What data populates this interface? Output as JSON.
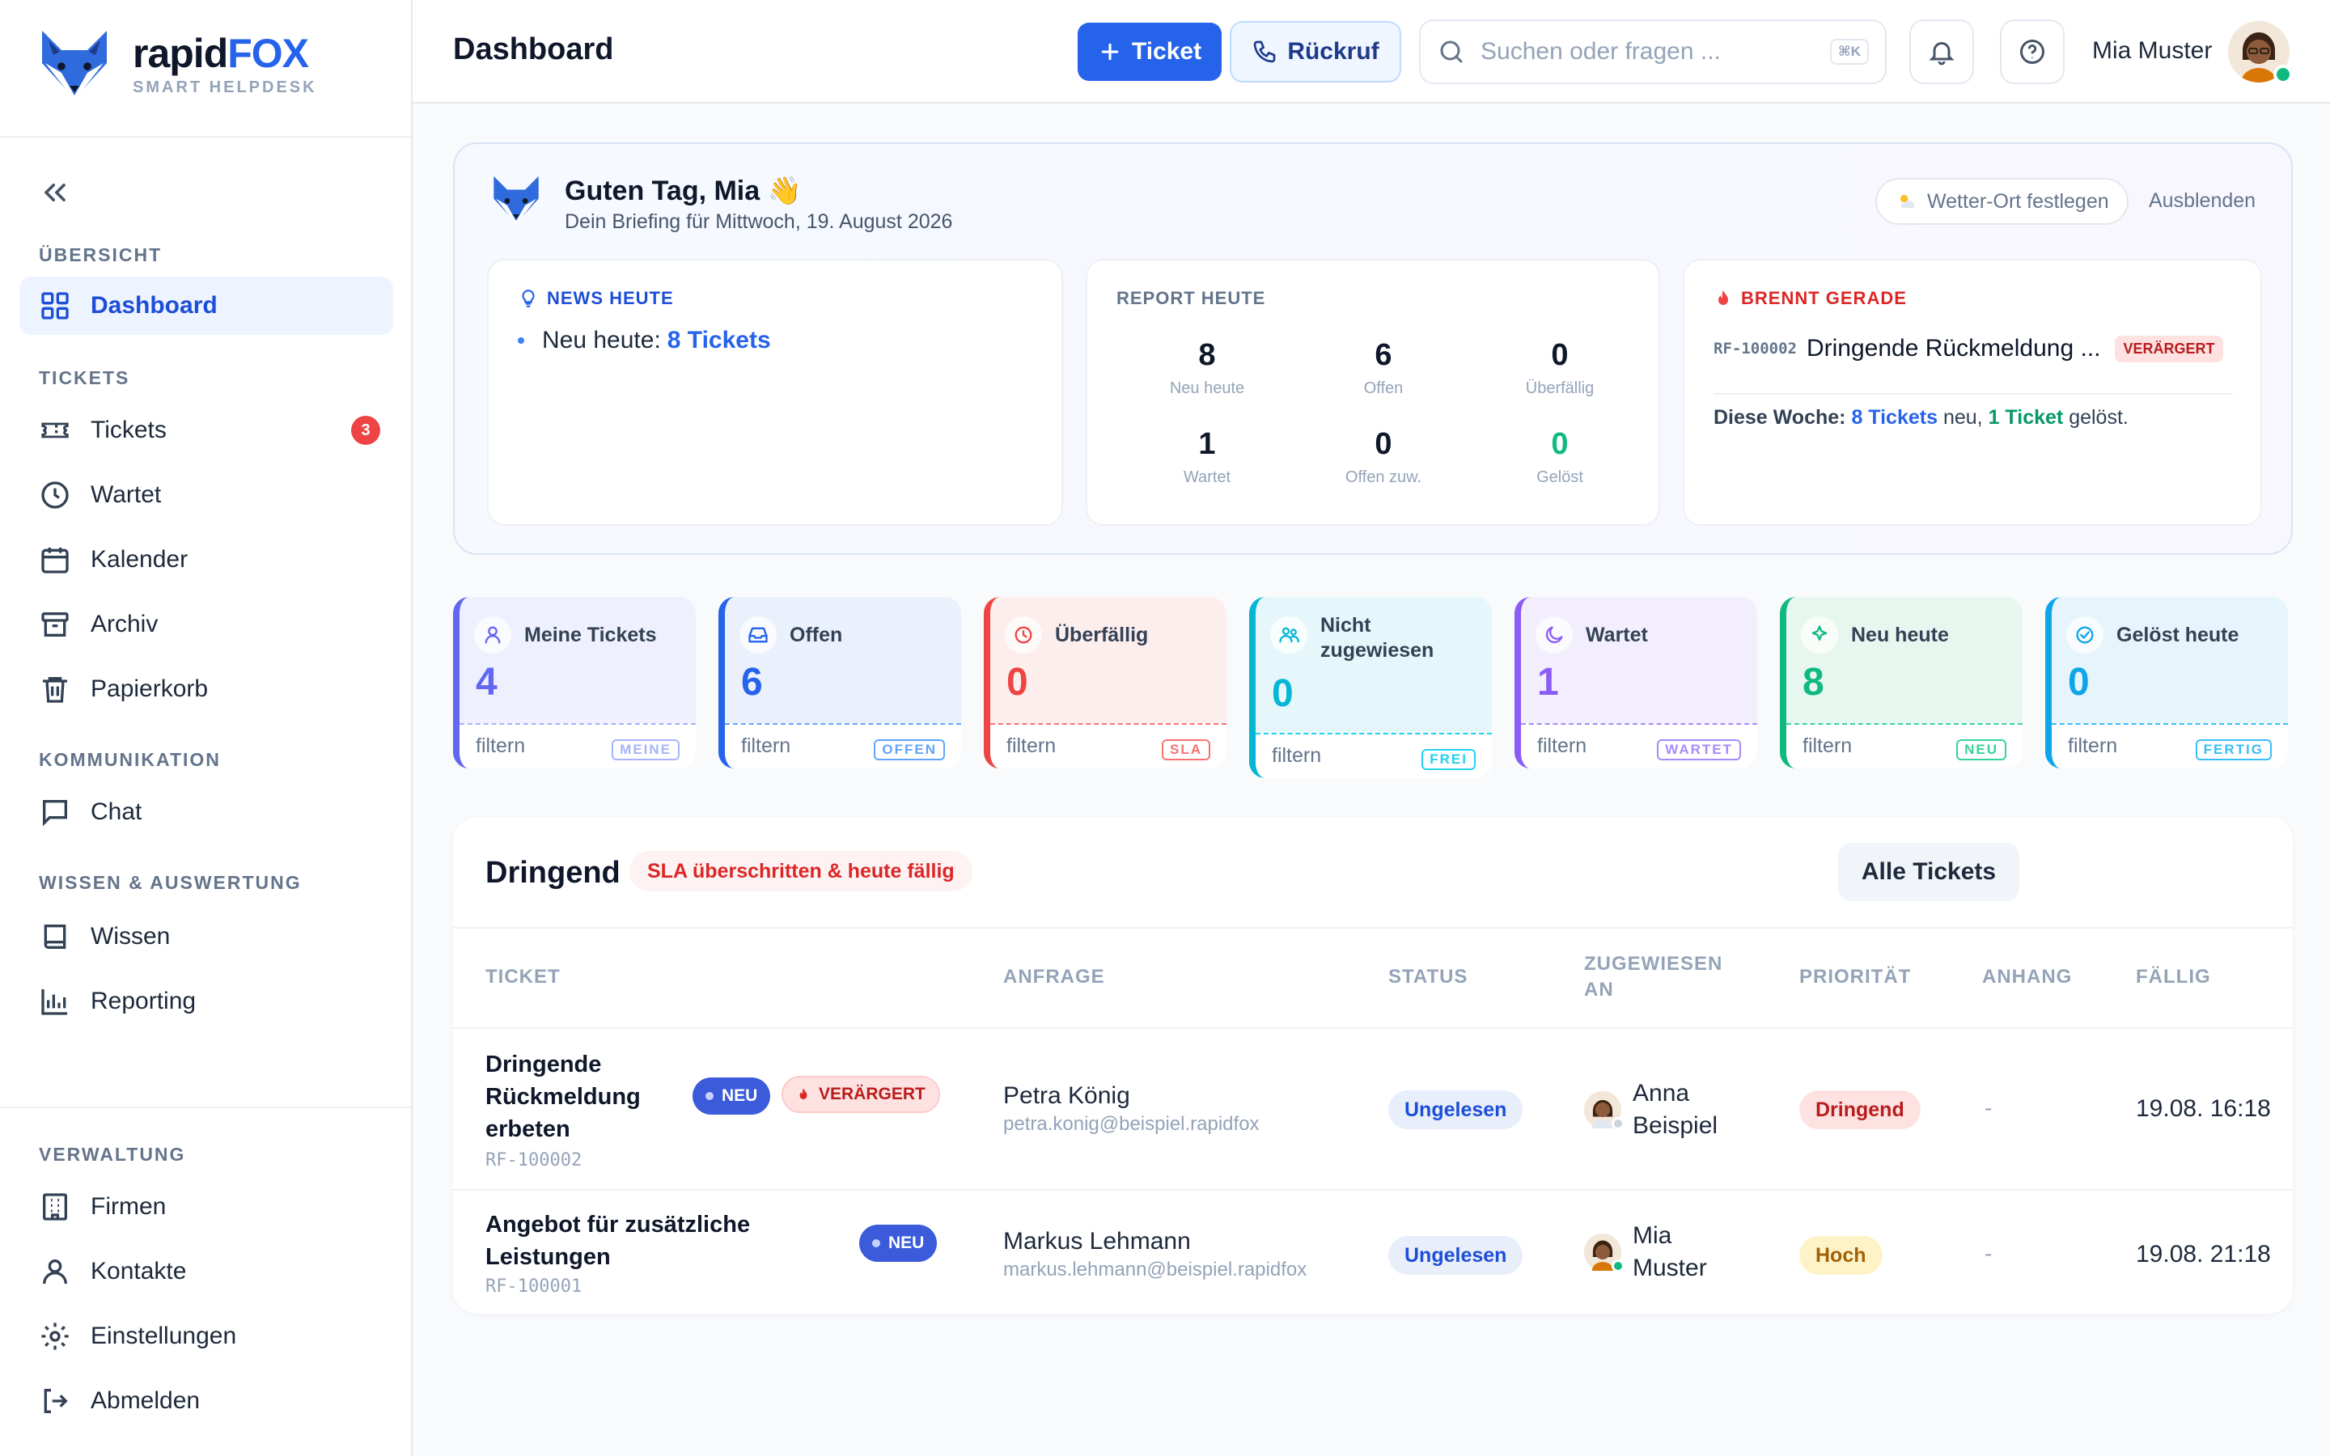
{
  "brand": {
    "name_dark": "rapid",
    "name_accent": "FOX",
    "tagline": "SMART HELPDESK"
  },
  "sidebar": {
    "sections": {
      "overview": "ÜBERSICHT",
      "tickets": "TICKETS",
      "communication": "KOMMUNIKATION",
      "knowledge": "WISSEN & AUSWERTUNG",
      "admin": "VERWALTUNG"
    },
    "items": {
      "dashboard": "Dashboard",
      "tickets": "Tickets",
      "tickets_badge": "3",
      "waiting": "Wartet",
      "calendar": "Kalender",
      "archive": "Archiv",
      "trash": "Papierkorb",
      "chat": "Chat",
      "knowledge": "Wissen",
      "reporting": "Reporting",
      "companies": "Firmen",
      "contacts": "Kontakte",
      "settings": "Einstellungen",
      "logout": "Abmelden"
    }
  },
  "header": {
    "title": "Dashboard",
    "new_ticket": "Ticket",
    "callback": "Rückruf",
    "search_placeholder": "Suchen oder fragen ...",
    "search_shortcut": "⌘K",
    "user_name": "Mia Muster"
  },
  "briefing": {
    "greeting": "Guten Tag, Mia 👋",
    "subtitle": "Dein Briefing für Mittwoch, 19. August 2026",
    "weather_btn": "Wetter-Ort festlegen",
    "hide_btn": "Ausblenden",
    "news": {
      "title": "NEWS HEUTE",
      "item_prefix": "Neu heute:",
      "item_link": "8 Tickets"
    },
    "report": {
      "title": "REPORT HEUTE",
      "cells": [
        {
          "value": "8",
          "label": "Neu heute"
        },
        {
          "value": "6",
          "label": "Offen"
        },
        {
          "value": "0",
          "label": "Überfällig"
        },
        {
          "value": "1",
          "label": "Wartet"
        },
        {
          "value": "0",
          "label": "Offen zuw."
        },
        {
          "value": "0",
          "label": "Gelöst"
        }
      ]
    },
    "burning": {
      "title": "BRENNT GERADE",
      "code": "RF-100002",
      "subject": "Dringende Rückmeldung ...",
      "tag": "VERÄRGERT",
      "week_prefix": "Diese Woche:",
      "week_new": "8 Tickets",
      "week_mid": "neu,",
      "week_solved": "1 Ticket",
      "week_suffix": "gelöst."
    }
  },
  "stats": [
    {
      "title": "Meine Tickets",
      "value": "4",
      "filter": "filtern",
      "chip": "MEINE",
      "color": "#6366f1"
    },
    {
      "title": "Offen",
      "value": "6",
      "filter": "filtern",
      "chip": "OFFEN",
      "color": "#2563eb"
    },
    {
      "title": "Überfällig",
      "value": "0",
      "filter": "filtern",
      "chip": "SLA",
      "color": "#ef4444"
    },
    {
      "title": "Nicht zugewiesen",
      "value": "0",
      "filter": "filtern",
      "chip": "FREI",
      "color": "#06b6d4"
    },
    {
      "title": "Wartet",
      "value": "1",
      "filter": "filtern",
      "chip": "WARTET",
      "color": "#8b5cf6"
    },
    {
      "title": "Neu heute",
      "value": "8",
      "filter": "filtern",
      "chip": "NEU",
      "color": "#10b981"
    },
    {
      "title": "Gelöst heute",
      "value": "0",
      "filter": "filtern",
      "chip": "FERTIG",
      "color": "#0ea5e9"
    }
  ],
  "urgent": {
    "title": "Dringend",
    "tag": "SLA überschritten & heute fällig",
    "all_button": "Alle Tickets",
    "columns": [
      "TICKET",
      "ANFRAGE",
      "STATUS",
      "ZUGEWIESEN AN",
      "PRIORITÄT",
      "ANHANG",
      "FÄLLIG"
    ],
    "rows": [
      {
        "title": "Dringende Rückmeldung erbeten",
        "code": "RF-100002",
        "tag_new": "NEU",
        "tag_mood": "VERÄRGERT",
        "requester": "Petra König",
        "email": "petra.konig@beispiel.rapidfox",
        "status": "Ungelesen",
        "assignee": "Anna Beispiel",
        "priority": "Dringend",
        "attachment": "-",
        "due": "19.08. 16:18"
      },
      {
        "title": "Angebot für zusätzliche Leistungen",
        "code": "RF-100001",
        "tag_new": "NEU",
        "requester": "Markus Lehmann",
        "email": "markus.lehmann@beispiel.rapidfox",
        "status": "Ungelesen",
        "assignee": "Mia Muster",
        "priority": "Hoch",
        "attachment": "-",
        "due": "19.08. 21:18"
      }
    ]
  }
}
